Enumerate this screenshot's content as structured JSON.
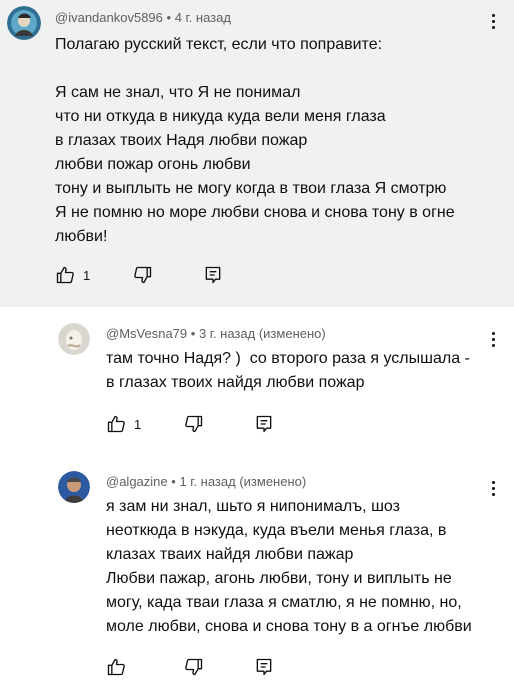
{
  "comments": [
    {
      "author": "@ivandankov5896",
      "time": "4 г. назад",
      "edited": "",
      "text": "Полагаю русский текст, если что поправите:\n\nЯ сам не знал, что Я не понимал\nчто ни откуда в никуда куда вели меня глаза\nв глазах твоих Надя любви пожар\nлюбви пожар огонь любви\nтону и выплыть не могу когда в твои глаза Я смотрю\nЯ не помню но море любви снова и снова тону в огне\nлюбви!",
      "likes": "1"
    },
    {
      "author": "@MsVesna79",
      "time": "3 г. назад",
      "edited": "(изменено)",
      "text": "там точно Надя? )  со второго раза я услышала -\nв глазах твоих найдя любви пожар",
      "likes": "1"
    },
    {
      "author": "@algazine",
      "time": "1 г. назад",
      "edited": "(изменено)",
      "text": "я зам ни знал, шьто я нипонималъ, шоз\nнеоткюда в нэкуда, куда въели менья глаза, в\nклазах тваих найдя любви пажар\nЛюбви пажар, агонь любви, тону и виплыть не\nмогу, када тваи глаза я сматлю, я не помню, но,\nмоле любви, снова и снова тону в а огнъе любви",
      "likes": ""
    }
  ],
  "separator": "•",
  "icons": {
    "like": "thumb-up-icon",
    "dislike": "thumb-down-icon",
    "reply": "reply-comment-icon",
    "more": "more-vertical-icon"
  },
  "colors": {
    "highlight_bg": "#f1f1f1",
    "meta": "#606060",
    "text": "#0f0f0f"
  }
}
